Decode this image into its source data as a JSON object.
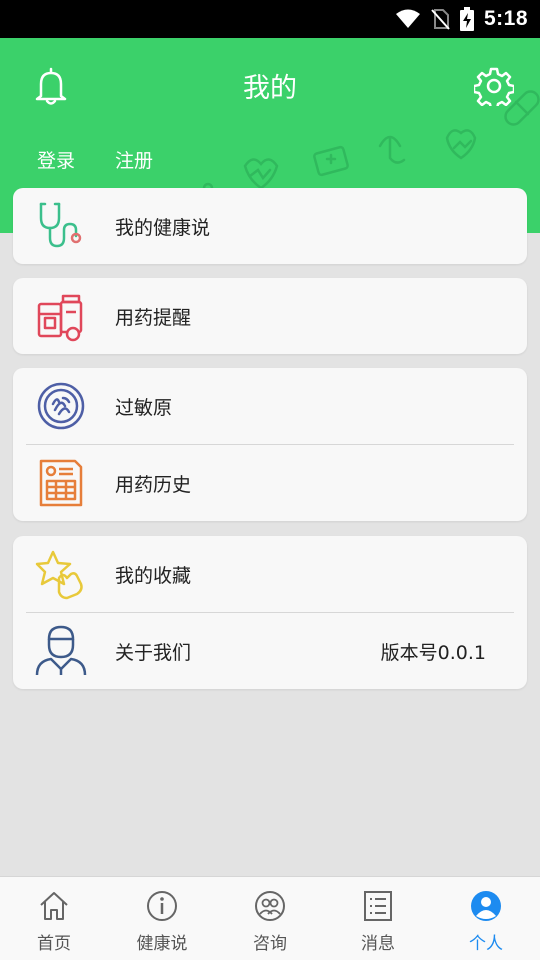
{
  "status_bar": {
    "time": "5:18"
  },
  "header": {
    "title": "我的",
    "login_label": "登录",
    "register_label": "注册",
    "background_color": "#3bd16a"
  },
  "menu": {
    "health_talk": "我的健康说",
    "medication_reminder": "用药提醒",
    "allergen": "过敏原",
    "medication_history": "用药历史",
    "favorites": "我的收藏",
    "about_us": "关于我们",
    "version": "版本号0.0.1"
  },
  "tabbar": {
    "active_color": "#1d8bf0",
    "tabs": [
      {
        "label": "首页",
        "icon": "home-icon"
      },
      {
        "label": "健康说",
        "icon": "info-icon"
      },
      {
        "label": "咨询",
        "icon": "consult-icon"
      },
      {
        "label": "消息",
        "icon": "list-icon"
      },
      {
        "label": "个人",
        "icon": "person-icon",
        "active": true
      }
    ]
  }
}
